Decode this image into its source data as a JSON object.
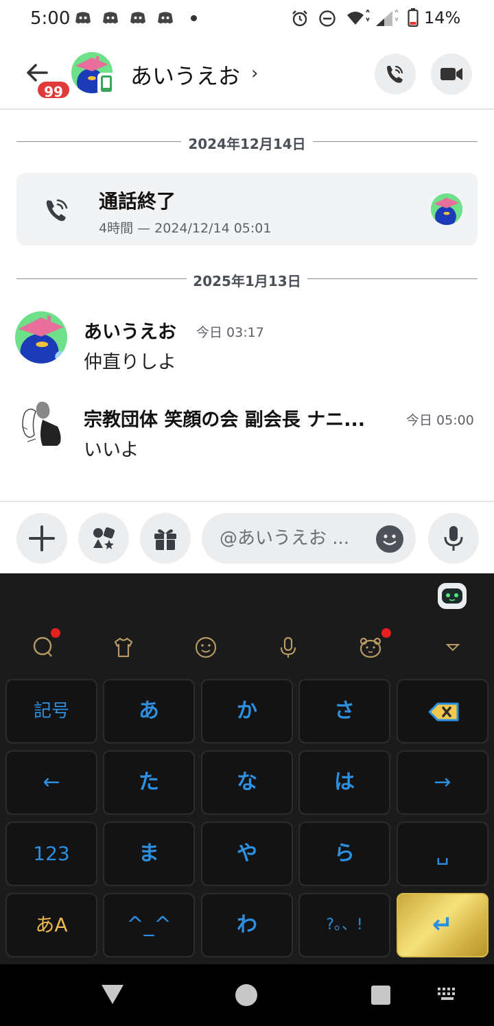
{
  "status_bar": {
    "time": "5:00",
    "battery": "14%",
    "icons": [
      "discord-icon",
      "discord-icon",
      "discord-icon",
      "discord-icon",
      "dot-icon",
      "alarm-icon",
      "dnd-icon",
      "wifi-icon",
      "signal-icon",
      "battery-icon"
    ]
  },
  "header": {
    "badge_count": "99",
    "title": "あいうえお",
    "chevron": "›",
    "actions": [
      "voice-call-icon",
      "video-call-icon"
    ]
  },
  "dividers": {
    "first": "2024年12月14日",
    "second": "2025年1月13日"
  },
  "call_card": {
    "title": "通話終了",
    "subtitle": "4時間 — 2024/12/14 05:01"
  },
  "messages": [
    {
      "name": "あいうえお",
      "time": "今日 03:17",
      "text": "仲直りしよ"
    },
    {
      "name": "宗教団体 笑顔の会 副会長 ナニ...",
      "time": "今日 05:00",
      "text": "いいよ"
    }
  ],
  "composer": {
    "placeholder": "@あいうえお ..."
  },
  "keyboard": {
    "rows": [
      [
        "記号",
        "あ",
        "か",
        "さ",
        "⌫"
      ],
      [
        "←",
        "た",
        "な",
        "は",
        "→"
      ],
      [
        "123",
        "ま",
        "や",
        "ら",
        "␣"
      ],
      [
        "あA",
        "^_^",
        "わ",
        "?。、!",
        "↵"
      ]
    ]
  },
  "colors": {
    "accent_blue": "#2d8fe0",
    "badge_red": "#e03a3a",
    "avatar_green": "#6fe08a",
    "enter_gold": "#e6c95a"
  }
}
